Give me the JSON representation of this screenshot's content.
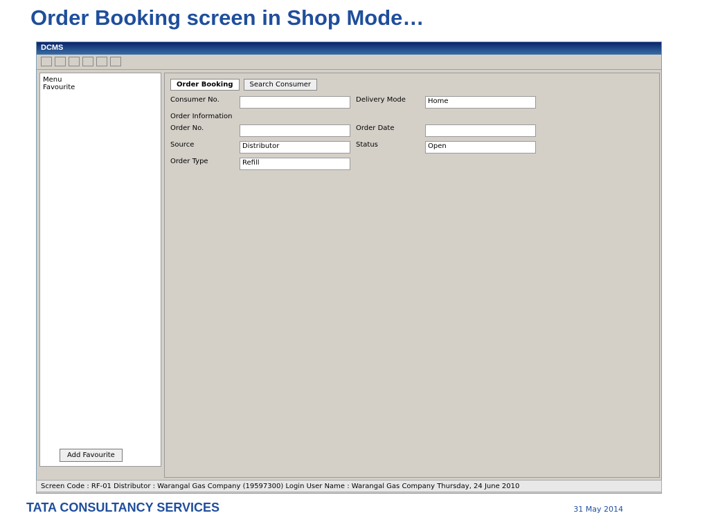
{
  "page_title": "Order Booking screen in Shop Mode…",
  "window_title": "DCMS",
  "tabs": [
    "Order Booking",
    "Search Consumer"
  ],
  "left": {
    "menu": "Menu",
    "favourite": "Favourite",
    "add_favourite": "Add Favourite"
  },
  "form": {
    "consumer_no": "Consumer No.",
    "delivery_mode_label": "Delivery Mode",
    "delivery_mode_value": "Home",
    "order_info": "Order Information",
    "order_no": "Order No.",
    "order_date": "Order Date",
    "source": "Source",
    "source_value": "Distributor",
    "status": "Status",
    "status_value": "Open",
    "order_type": "Order Type",
    "order_type_value": "Refill"
  },
  "status_bar": "Screen Code : RF-01   Distributor : Warangal Gas Company (19597300)   Login User Name : Warangal Gas Company   Thursday, 24 June 2010",
  "footer_left": "TATA CONSULTANCY SERVICES",
  "footer_right": "31 May 2014"
}
